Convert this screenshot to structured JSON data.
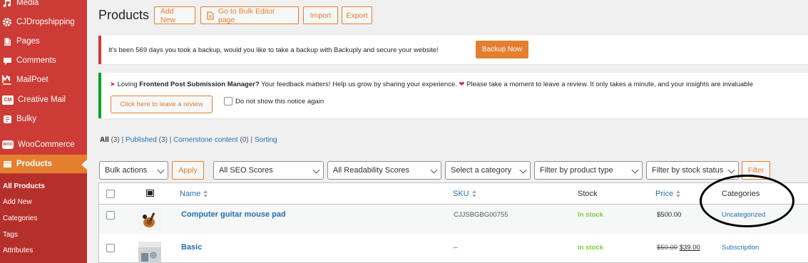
{
  "sidebar": {
    "items": [
      {
        "label": "Media",
        "icon": "media-icon"
      },
      {
        "label": "CJDropshipping",
        "icon": "gear-icon"
      },
      {
        "label": "Pages",
        "icon": "page-icon"
      },
      {
        "label": "Comments",
        "icon": "comment-icon"
      },
      {
        "label": "MailPoet",
        "icon": "mailpoet-icon"
      },
      {
        "label": "Creative Mail",
        "icon": "creative-mail-icon"
      },
      {
        "label": "Bulky",
        "icon": "bulky-icon"
      },
      {
        "label": "WooCommerce",
        "icon": "woocommerce-icon"
      },
      {
        "label": "Products",
        "icon": "products-icon"
      }
    ],
    "cm_badge": "CM",
    "woo_badge": "WOO",
    "submenu": [
      "All Products",
      "Add New",
      "Categories",
      "Tags",
      "Attributes"
    ]
  },
  "header": {
    "title": "Products",
    "add_new": "Add New",
    "bulk_editor": "Go to Bulk Editor page",
    "import": "Import",
    "export": "Export"
  },
  "notice_backup": {
    "text": "It's been 569 days you took a backup, would you like to take a backup with Backuply and secure your website!",
    "button": "Backup Now"
  },
  "notice_review": {
    "text_before": "Loving",
    "product": "Frontend Post Submission Manager?",
    "text_mid": "Your feedback matters! Help us grow by sharing your experience.",
    "text_after": "Please take a moment to leave a review. It only takes a minute, and your insights are invaluable",
    "button": "Click here to leave a review",
    "checkbox_label": "Do not show this notice again"
  },
  "views": {
    "all": "All",
    "all_count": "(3)",
    "published": "Published",
    "published_count": "(3)",
    "cornerstone": "Cornerstone content",
    "cornerstone_count": "(0)",
    "sorting": "Sorting",
    "sep": "|"
  },
  "filters": {
    "bulk_actions": "Bulk actions",
    "apply": "Apply",
    "seo": "All SEO Scores",
    "readability": "All Readability Scores",
    "category": "Select a category",
    "product_type": "Filter by product type",
    "stock_status": "Filter by stock status",
    "filter": "Filter"
  },
  "table": {
    "columns": {
      "name": "Name",
      "sku": "SKU",
      "stock": "Stock",
      "price": "Price",
      "categories": "Categories"
    },
    "rows": [
      {
        "name": "Computer guitar mouse pad",
        "sku": "CJJSBGBG00755",
        "stock": "In stock",
        "price": "$500.00",
        "price_old": "",
        "category": "Uncategorized"
      },
      {
        "name": "Basic",
        "sku": "–",
        "stock": "In stock",
        "price": "$39.00",
        "price_old": "$50.00",
        "category": "Subscription"
      }
    ]
  },
  "colors": {
    "sidebar": "#cc3b35",
    "accent": "#e37f2f",
    "link": "#2271b1",
    "in_stock": "#7ad03a"
  }
}
